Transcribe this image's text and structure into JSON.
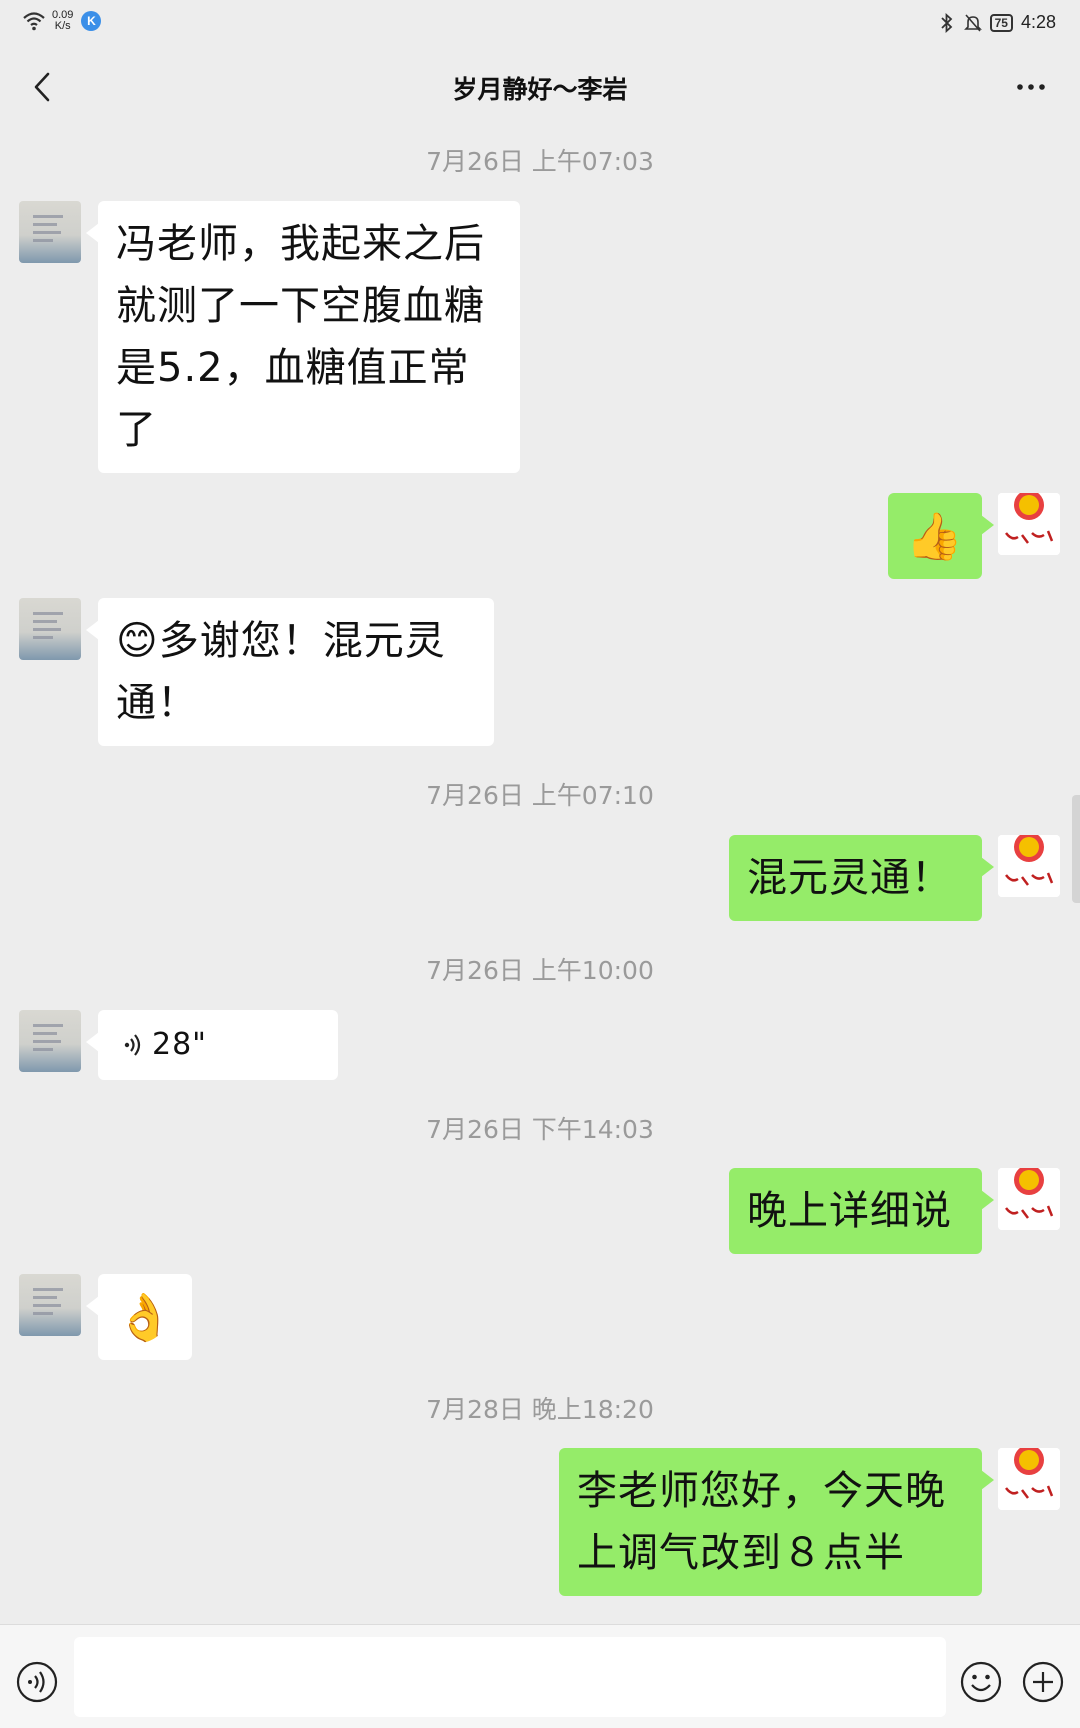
{
  "status_bar": {
    "net_speed_value": "0.09",
    "net_speed_unit": "K/s",
    "app_badge": "K",
    "battery": "75",
    "time": "4:28"
  },
  "header": {
    "title": "岁月静好～李岩",
    "back_icon": "chevron-left-icon",
    "more_icon": "more-dots-icon"
  },
  "messages": [
    {
      "type": "timestamp",
      "text": "7月26日 上午07:03"
    },
    {
      "type": "text",
      "from": "other",
      "text": "冯老师，我起来之后就测了一下空腹血糖是5.2，血糖值正常了"
    },
    {
      "type": "emoji",
      "from": "self",
      "emoji": "👍"
    },
    {
      "type": "text",
      "from": "other",
      "text": "😊多谢您！混元灵通！"
    },
    {
      "type": "timestamp",
      "text": "7月26日 上午07:10"
    },
    {
      "type": "text",
      "from": "self",
      "text": "混元灵通！"
    },
    {
      "type": "timestamp",
      "text": "7月26日 上午10:00"
    },
    {
      "type": "voice",
      "from": "other",
      "duration": "28\""
    },
    {
      "type": "timestamp",
      "text": "7月26日 下午14:03"
    },
    {
      "type": "text",
      "from": "self",
      "text": "晚上详细说"
    },
    {
      "type": "emoji",
      "from": "other",
      "emoji": "👌"
    },
    {
      "type": "timestamp",
      "text": "7月28日 晚上18:20"
    },
    {
      "type": "text",
      "from": "self",
      "text": "李老师您好，今天晚上调气改到８点半"
    }
  ],
  "input": {
    "placeholder": "",
    "value": ""
  },
  "colors": {
    "background": "#ededed",
    "outgoing_bubble": "#95ec69",
    "incoming_bubble": "#ffffff",
    "timestamp": "#9a9a9a"
  }
}
